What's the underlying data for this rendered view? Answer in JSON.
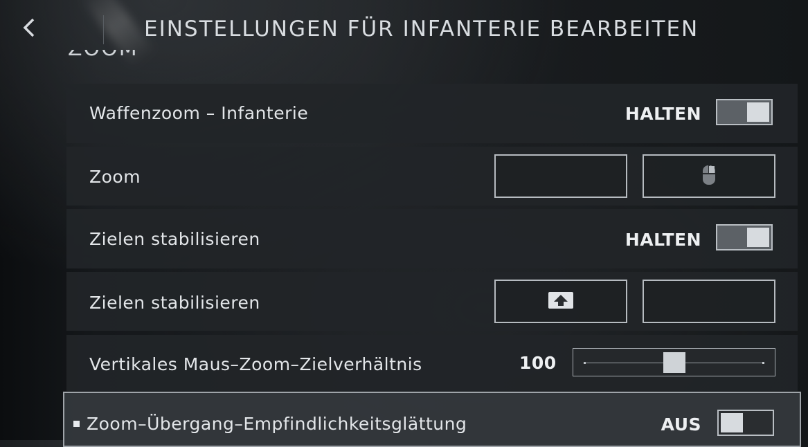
{
  "header": {
    "title": "EINSTELLUNGEN FÜR INFANTERIE BEARBEITEN",
    "back_icon": "chevron-left-icon"
  },
  "section": {
    "label": "ZOOM"
  },
  "rows": [
    {
      "label": "Waffenzoom – Infanterie",
      "type": "toggle",
      "value": "HALTEN",
      "state": "on"
    },
    {
      "label": "Zoom",
      "type": "keybind",
      "primary_icon": "",
      "secondary_icon": "mouse-right-button-icon"
    },
    {
      "label": "Zielen stabilisieren",
      "type": "toggle",
      "value": "HALTEN",
      "state": "on"
    },
    {
      "label": "Zielen stabilisieren",
      "type": "keybind",
      "primary_icon": "shift-key-icon",
      "secondary_icon": ""
    },
    {
      "label": "Vertikales Maus–Zoom–Zielverhältnis",
      "type": "slider",
      "value": "100",
      "fraction": 0.5
    },
    {
      "label": "Zoom–Übergang–Empfindlichkeitsglättung",
      "type": "toggle",
      "value": "AUS",
      "state": "off",
      "selected": true
    }
  ],
  "colors": {
    "row_bg": "#222528",
    "selected_bg": "#34383c",
    "toggle_knob": "#d7dbdf"
  }
}
